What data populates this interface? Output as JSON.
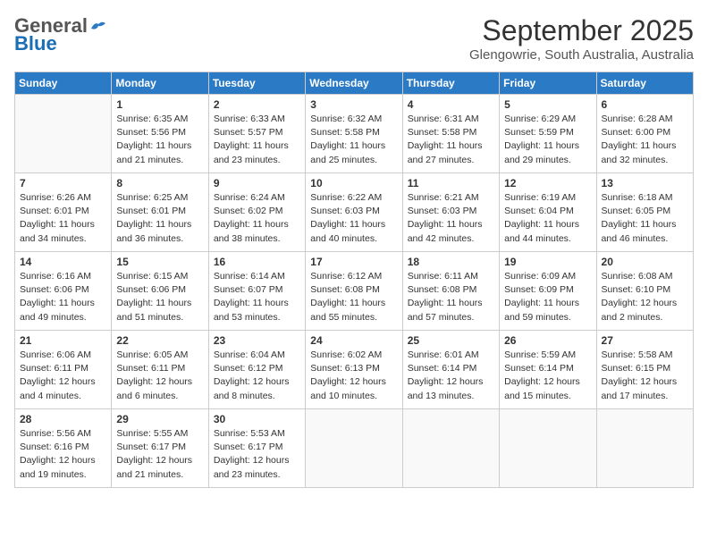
{
  "logo": {
    "general": "General",
    "blue": "Blue"
  },
  "title": "September 2025",
  "subtitle": "Glengowrie, South Australia, Australia",
  "days_of_week": [
    "Sunday",
    "Monday",
    "Tuesday",
    "Wednesday",
    "Thursday",
    "Friday",
    "Saturday"
  ],
  "weeks": [
    [
      {
        "day": "",
        "info": ""
      },
      {
        "day": "1",
        "info": "Sunrise: 6:35 AM\nSunset: 5:56 PM\nDaylight: 11 hours\nand 21 minutes."
      },
      {
        "day": "2",
        "info": "Sunrise: 6:33 AM\nSunset: 5:57 PM\nDaylight: 11 hours\nand 23 minutes."
      },
      {
        "day": "3",
        "info": "Sunrise: 6:32 AM\nSunset: 5:58 PM\nDaylight: 11 hours\nand 25 minutes."
      },
      {
        "day": "4",
        "info": "Sunrise: 6:31 AM\nSunset: 5:58 PM\nDaylight: 11 hours\nand 27 minutes."
      },
      {
        "day": "5",
        "info": "Sunrise: 6:29 AM\nSunset: 5:59 PM\nDaylight: 11 hours\nand 29 minutes."
      },
      {
        "day": "6",
        "info": "Sunrise: 6:28 AM\nSunset: 6:00 PM\nDaylight: 11 hours\nand 32 minutes."
      }
    ],
    [
      {
        "day": "7",
        "info": "Sunrise: 6:26 AM\nSunset: 6:01 PM\nDaylight: 11 hours\nand 34 minutes."
      },
      {
        "day": "8",
        "info": "Sunrise: 6:25 AM\nSunset: 6:01 PM\nDaylight: 11 hours\nand 36 minutes."
      },
      {
        "day": "9",
        "info": "Sunrise: 6:24 AM\nSunset: 6:02 PM\nDaylight: 11 hours\nand 38 minutes."
      },
      {
        "day": "10",
        "info": "Sunrise: 6:22 AM\nSunset: 6:03 PM\nDaylight: 11 hours\nand 40 minutes."
      },
      {
        "day": "11",
        "info": "Sunrise: 6:21 AM\nSunset: 6:03 PM\nDaylight: 11 hours\nand 42 minutes."
      },
      {
        "day": "12",
        "info": "Sunrise: 6:19 AM\nSunset: 6:04 PM\nDaylight: 11 hours\nand 44 minutes."
      },
      {
        "day": "13",
        "info": "Sunrise: 6:18 AM\nSunset: 6:05 PM\nDaylight: 11 hours\nand 46 minutes."
      }
    ],
    [
      {
        "day": "14",
        "info": "Sunrise: 6:16 AM\nSunset: 6:06 PM\nDaylight: 11 hours\nand 49 minutes."
      },
      {
        "day": "15",
        "info": "Sunrise: 6:15 AM\nSunset: 6:06 PM\nDaylight: 11 hours\nand 51 minutes."
      },
      {
        "day": "16",
        "info": "Sunrise: 6:14 AM\nSunset: 6:07 PM\nDaylight: 11 hours\nand 53 minutes."
      },
      {
        "day": "17",
        "info": "Sunrise: 6:12 AM\nSunset: 6:08 PM\nDaylight: 11 hours\nand 55 minutes."
      },
      {
        "day": "18",
        "info": "Sunrise: 6:11 AM\nSunset: 6:08 PM\nDaylight: 11 hours\nand 57 minutes."
      },
      {
        "day": "19",
        "info": "Sunrise: 6:09 AM\nSunset: 6:09 PM\nDaylight: 11 hours\nand 59 minutes."
      },
      {
        "day": "20",
        "info": "Sunrise: 6:08 AM\nSunset: 6:10 PM\nDaylight: 12 hours\nand 2 minutes."
      }
    ],
    [
      {
        "day": "21",
        "info": "Sunrise: 6:06 AM\nSunset: 6:11 PM\nDaylight: 12 hours\nand 4 minutes."
      },
      {
        "day": "22",
        "info": "Sunrise: 6:05 AM\nSunset: 6:11 PM\nDaylight: 12 hours\nand 6 minutes."
      },
      {
        "day": "23",
        "info": "Sunrise: 6:04 AM\nSunset: 6:12 PM\nDaylight: 12 hours\nand 8 minutes."
      },
      {
        "day": "24",
        "info": "Sunrise: 6:02 AM\nSunset: 6:13 PM\nDaylight: 12 hours\nand 10 minutes."
      },
      {
        "day": "25",
        "info": "Sunrise: 6:01 AM\nSunset: 6:14 PM\nDaylight: 12 hours\nand 13 minutes."
      },
      {
        "day": "26",
        "info": "Sunrise: 5:59 AM\nSunset: 6:14 PM\nDaylight: 12 hours\nand 15 minutes."
      },
      {
        "day": "27",
        "info": "Sunrise: 5:58 AM\nSunset: 6:15 PM\nDaylight: 12 hours\nand 17 minutes."
      }
    ],
    [
      {
        "day": "28",
        "info": "Sunrise: 5:56 AM\nSunset: 6:16 PM\nDaylight: 12 hours\nand 19 minutes."
      },
      {
        "day": "29",
        "info": "Sunrise: 5:55 AM\nSunset: 6:17 PM\nDaylight: 12 hours\nand 21 minutes."
      },
      {
        "day": "30",
        "info": "Sunrise: 5:53 AM\nSunset: 6:17 PM\nDaylight: 12 hours\nand 23 minutes."
      },
      {
        "day": "",
        "info": ""
      },
      {
        "day": "",
        "info": ""
      },
      {
        "day": "",
        "info": ""
      },
      {
        "day": "",
        "info": ""
      }
    ]
  ]
}
